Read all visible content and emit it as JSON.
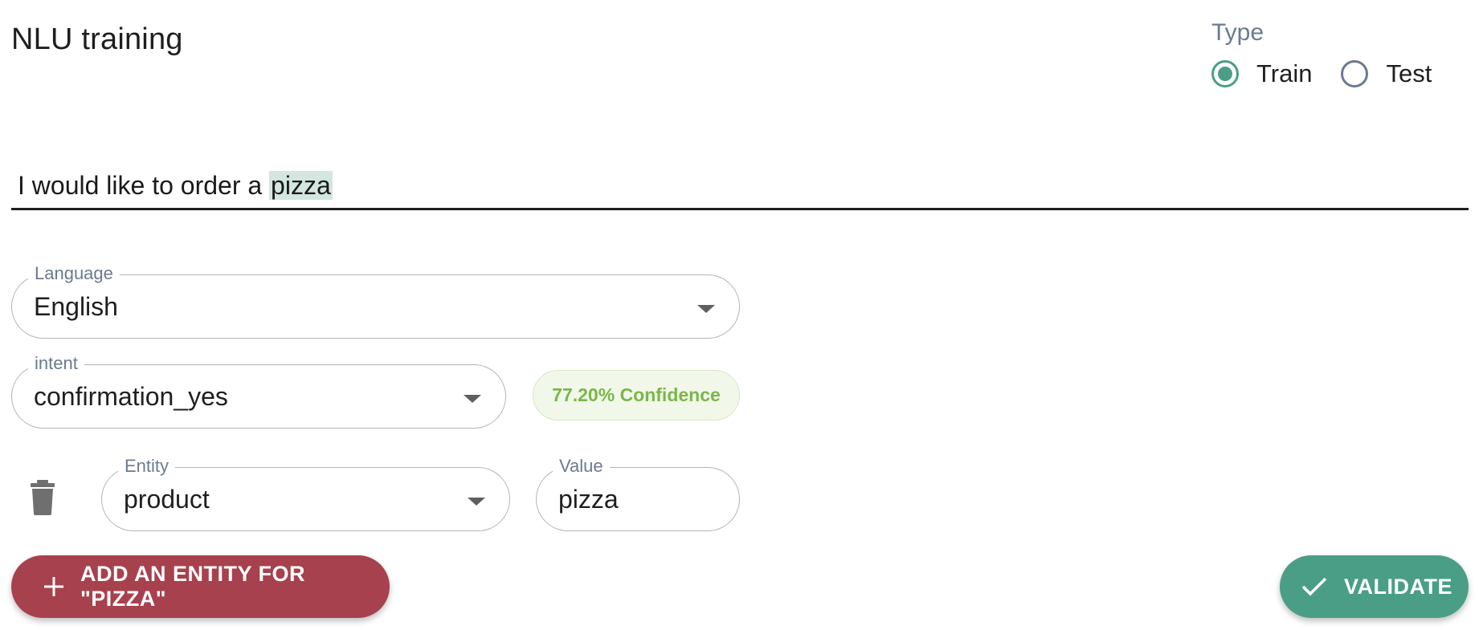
{
  "header": {
    "title": "NLU training"
  },
  "type_selector": {
    "label": "Type",
    "options": [
      {
        "label": "Train",
        "checked": true
      },
      {
        "label": "Test",
        "checked": false
      }
    ]
  },
  "utterance": {
    "prefix": "I would like to order a ",
    "highlighted": "pizza"
  },
  "language": {
    "label": "Language",
    "value": "English"
  },
  "intent": {
    "label": "intent",
    "value": "confirmation_yes",
    "confidence_text": "77.20% Confidence"
  },
  "entity": {
    "label": "Entity",
    "value": "product",
    "value_label": "Value",
    "value_text": "pizza"
  },
  "actions": {
    "add_entity_label": "ADD AN ENTITY FOR \"PIZZA\"",
    "validate_label": "VALIDATE"
  },
  "colors": {
    "primary": "#4a9e86",
    "danger": "#a7414d",
    "confidence_text": "#7ab648",
    "confidence_bg": "#f1f8ea",
    "label": "#6b7a90"
  },
  "icons": {
    "trash": "trash-icon",
    "plus": "plus-icon",
    "check": "check-icon",
    "dropdown": "chevron-down-icon"
  }
}
